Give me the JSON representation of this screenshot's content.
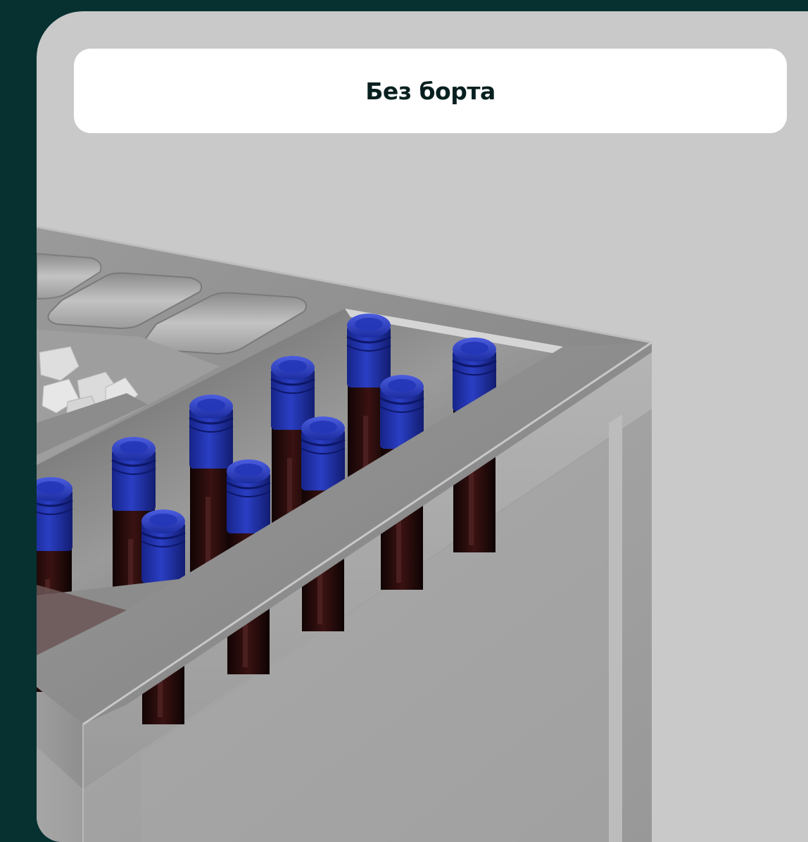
{
  "title": {
    "text": "Без борта"
  },
  "image": {
    "subject": "stainless-steel-bar-station-with-bottles"
  },
  "colors": {
    "page_background": "#063130",
    "card_background": "#c9c9c9",
    "label_background": "#ffffff",
    "label_text": "#08201f",
    "bottle_cap": "#1c2ea8"
  }
}
